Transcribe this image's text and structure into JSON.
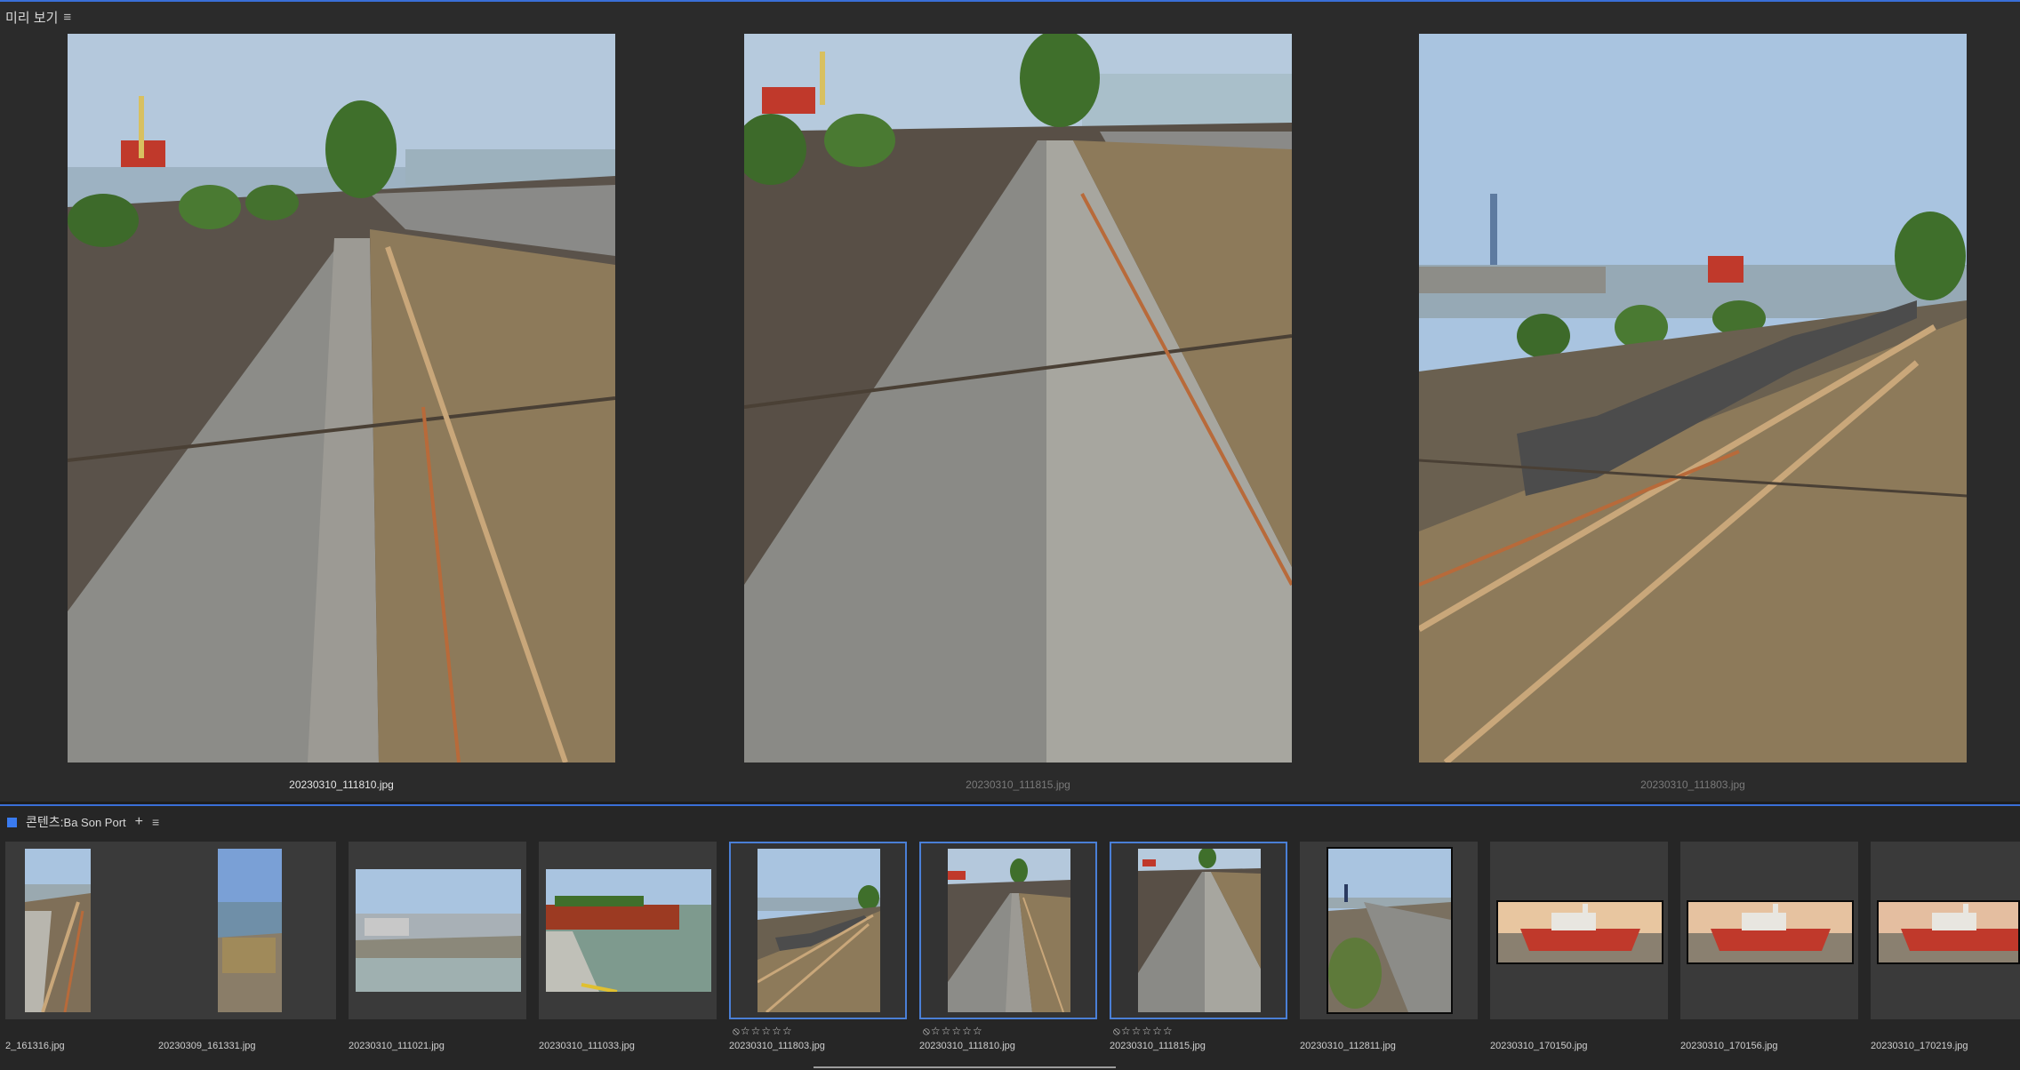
{
  "preview": {
    "title": "미리 보기",
    "menu_icon": "≡",
    "items": [
      {
        "caption": "20230310_111810.jpg",
        "state": "active"
      },
      {
        "caption": "20230310_111815.jpg",
        "state": "dim"
      },
      {
        "caption": "20230310_111803.jpg",
        "state": "dim"
      }
    ]
  },
  "content": {
    "title_prefix": "콘텐츠:",
    "folder": "Ba Son Port",
    "add_icon": "+",
    "menu_icon": "≡",
    "thumbnails": [
      {
        "caption": "2_161316.jpg",
        "rating": ""
      },
      {
        "caption": "20230309_161331.jpg",
        "rating": ""
      },
      {
        "caption": "20230310_111021.jpg",
        "rating": ""
      },
      {
        "caption": "20230310_111033.jpg",
        "rating": ""
      },
      {
        "caption": "20230310_111803.jpg",
        "rating": "⦸☆☆☆☆☆"
      },
      {
        "caption": "20230310_111810.jpg",
        "rating": "⦸☆☆☆☆☆"
      },
      {
        "caption": "20230310_111815.jpg",
        "rating": "⦸☆☆☆☆☆"
      },
      {
        "caption": "20230310_112811.jpg",
        "rating": ""
      },
      {
        "caption": "20230310_170150.jpg",
        "rating": ""
      },
      {
        "caption": "20230310_170156.jpg",
        "rating": ""
      },
      {
        "caption": "20230310_170219.jpg",
        "rating": ""
      }
    ]
  },
  "colors": {
    "accent": "#3a6fd8",
    "panel_bg": "#2b2b2b",
    "thumb_bg": "#3a3a3a"
  }
}
